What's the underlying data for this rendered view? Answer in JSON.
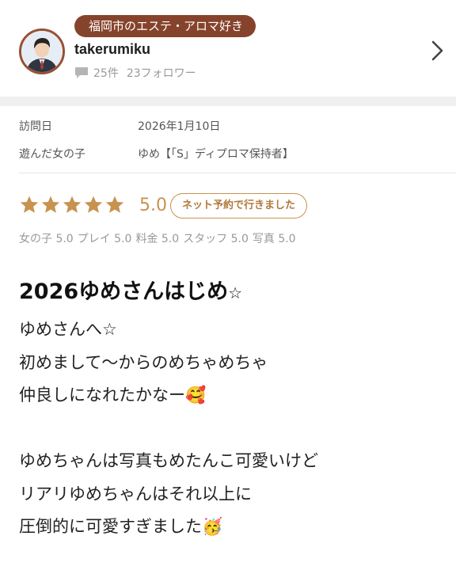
{
  "profile": {
    "tag": "福岡市のエステ・アロマ好き",
    "username": "takerumiku",
    "review_count": "25件",
    "followers": "23フォロワー"
  },
  "visit": {
    "date_label": "訪問日",
    "date_value": "2026年1月10日",
    "girl_label": "遊んだ女の子",
    "girl_value": "ゆめ【「S」ディプロマ保持者】"
  },
  "rating": {
    "stars": 5,
    "score": "5.0",
    "badge": "ネット予約で行きました",
    "subscores": [
      {
        "label": "女の子",
        "value": "5.0"
      },
      {
        "label": "プレイ",
        "value": "5.0"
      },
      {
        "label": "料金",
        "value": "5.0"
      },
      {
        "label": "スタッフ",
        "value": "5.0"
      },
      {
        "label": "写真",
        "value": "5.0"
      }
    ]
  },
  "review": {
    "title": "2026ゆめさんはじめ",
    "title_suffix": "☆",
    "lines": [
      "ゆめさんへ☆",
      "初めまして〜からのめちゃめちゃ",
      "仲良しになれたかなー🥰",
      "",
      "ゆめちゃんは写真もめたんこ可愛いけど",
      "リアリゆめちゃんはそれ以上に",
      "圧倒的に可愛すぎました🥳"
    ]
  },
  "colors": {
    "accent": "#c8924f",
    "tag_bg": "#86432c",
    "text": "#222222",
    "muted": "#999999"
  },
  "icons": {
    "avatar": "user-avatar",
    "comment": "comment-icon",
    "chevron": "chevron-right-icon",
    "star": "star-icon"
  }
}
